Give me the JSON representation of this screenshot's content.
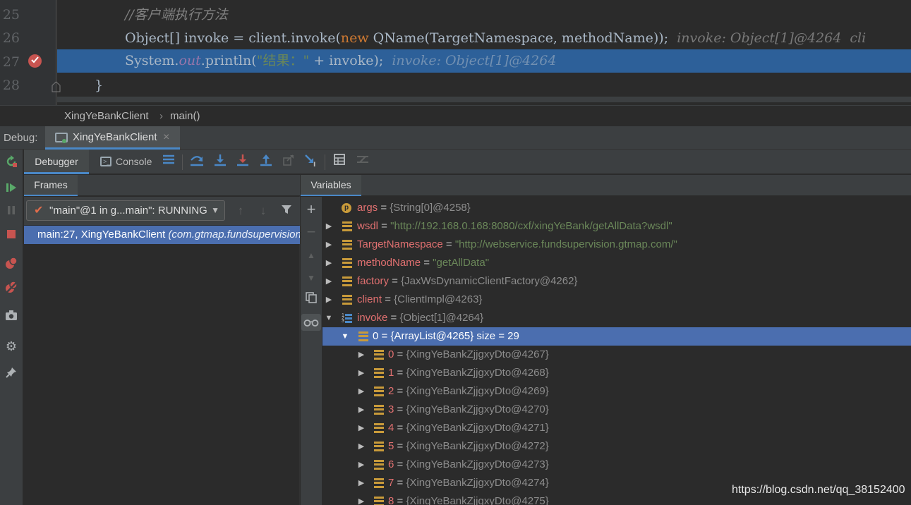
{
  "editor": {
    "line_numbers": [
      "25",
      "26",
      "27",
      "28"
    ],
    "line25": {
      "comment": "//客户端执行方法"
    },
    "line26": {
      "p1": "Object[] invoke = client.invoke(",
      "kw": "new",
      "p2": " QName(TargetNamespace, methodName));",
      "inline": "  invoke: Object[1]@4264  cli"
    },
    "line27": {
      "p1": "System.",
      "field": "out",
      "p2": ".println(",
      "str": "\"结果：\"",
      "p3": " + invoke);",
      "inline": "  invoke: Object[1]@4264"
    },
    "line28": {
      "brace": "}"
    },
    "breakpoint_icon": "breakpoint-check-icon",
    "fold_icon": "fold-marker-icon"
  },
  "breadcrumb": {
    "class_name": "XingYeBankClient",
    "separator": "›",
    "method": "main()"
  },
  "debug_header": {
    "label": "Debug:",
    "tab": "XingYeBankClient",
    "close": "×"
  },
  "toolbar": {
    "debugger_tab": "Debugger",
    "console_tab": "Console",
    "console_icon": ">_",
    "buttons": [
      "show-execution-point-icon",
      "step-over-icon",
      "step-into-icon",
      "force-step-into-icon",
      "step-out-icon",
      "drop-frame-icon",
      "run-to-cursor-icon",
      "evaluate-expression-icon",
      "trace-stream-icon"
    ]
  },
  "left_strip": [
    "rerun-icon",
    "resume-icon",
    "pause-icon",
    "stop-icon",
    "view-breakpoints-icon",
    "mute-breakpoints-icon",
    "camera-icon",
    "settings-icon",
    "pin-icon"
  ],
  "frames": {
    "title": "Frames",
    "thread": "\"main\"@1 in g...main\": RUNNING",
    "frame_location": "main:27, XingYeBankClient ",
    "frame_package": "(com.gtmap.fundsupervision"
  },
  "variables": {
    "title": "Variables",
    "rows": [
      {
        "name": "args",
        "eq": " = ",
        "value": "{String[0]@4258}",
        "extra": ""
      },
      {
        "name": "wsdl",
        "eq": " = ",
        "value": "\"http://192.168.0.168:8080/cxf/xingYeBank/getAllData?wsdl\"",
        "extra": ""
      },
      {
        "name": "TargetNamespace",
        "eq": " = ",
        "value": "\"http://webservice.fundsupervision.gtmap.com/\"",
        "extra": ""
      },
      {
        "name": "methodName",
        "eq": " = ",
        "value": "\"getAllData\"",
        "extra": ""
      },
      {
        "name": "factory",
        "eq": " = ",
        "value": "{JaxWsDynamicClientFactory@4262}",
        "extra": ""
      },
      {
        "name": "client",
        "eq": " = ",
        "value": "{ClientImpl@4263}",
        "extra": ""
      },
      {
        "name": "invoke",
        "eq": " = ",
        "value": "{Object[1]@4264}",
        "extra": ""
      },
      {
        "name": "0",
        "eq": " = ",
        "value": "{ArrayList@4265}",
        "extra": "  size = 29"
      },
      {
        "name": "0",
        "eq": " = ",
        "value": "{XingYeBankZjjgxyDto@4267}",
        "extra": ""
      },
      {
        "name": "1",
        "eq": " = ",
        "value": "{XingYeBankZjjgxyDto@4268}",
        "extra": ""
      },
      {
        "name": "2",
        "eq": " = ",
        "value": "{XingYeBankZjjgxyDto@4269}",
        "extra": ""
      },
      {
        "name": "3",
        "eq": " = ",
        "value": "{XingYeBankZjjgxyDto@4270}",
        "extra": ""
      },
      {
        "name": "4",
        "eq": " = ",
        "value": "{XingYeBankZjjgxyDto@4271}",
        "extra": ""
      },
      {
        "name": "5",
        "eq": " = ",
        "value": "{XingYeBankZjjgxyDto@4272}",
        "extra": ""
      },
      {
        "name": "6",
        "eq": " = ",
        "value": "{XingYeBankZjjgxyDto@4273}",
        "extra": ""
      },
      {
        "name": "7",
        "eq": " = ",
        "value": "{XingYeBankZjjgxyDto@4274}",
        "extra": ""
      },
      {
        "name": "8",
        "eq": " = ",
        "value": "{XingYeBankZjjgxyDto@4275}",
        "extra": ""
      }
    ]
  },
  "watermark": "https://blog.csdn.net/qq_38152400",
  "colors": {
    "accent": "#4a88c7",
    "selection": "#4b6eaf",
    "line_highlight": "#2d6099",
    "var_name": "#e07070",
    "string": "#6a8759",
    "keyword": "#cc7832"
  }
}
